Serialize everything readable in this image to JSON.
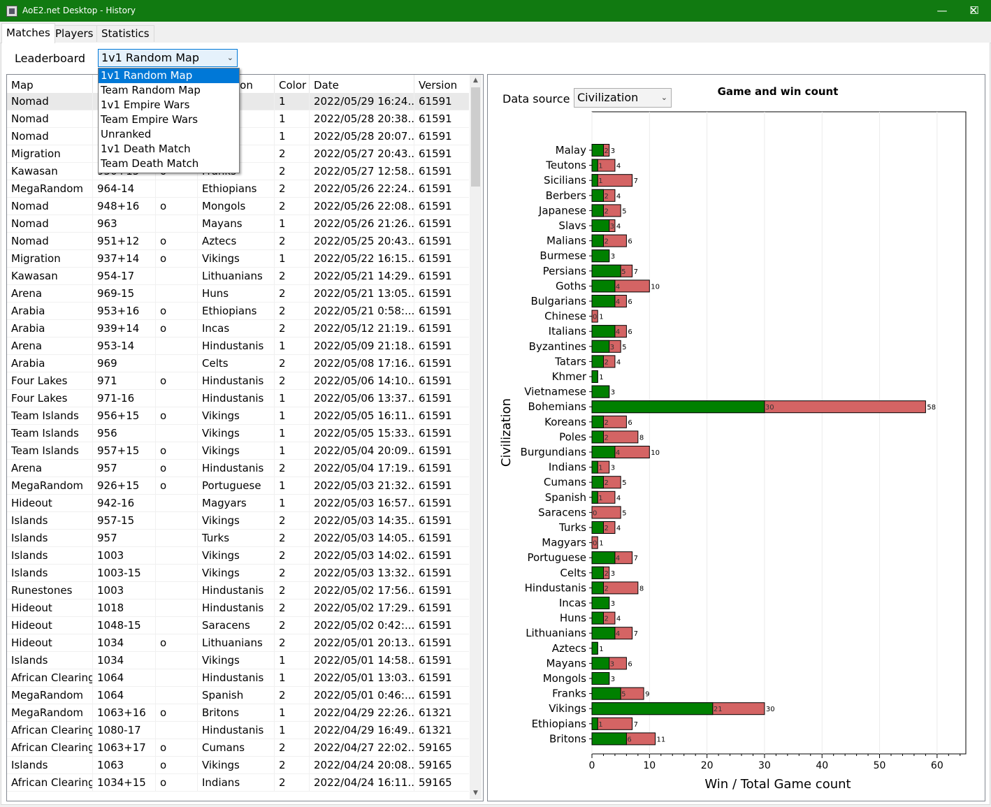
{
  "window": {
    "title": "AoE2.net Desktop - History",
    "minimize": "—",
    "maximize": "☐",
    "close": "✕"
  },
  "tabs": [
    "Matches",
    "Players",
    "Statistics"
  ],
  "leaderboard": {
    "label": "Leaderboard",
    "selected": "1v1 Random Map",
    "options": [
      "1v1 Random Map",
      "Team Random Map",
      "1v1 Empire Wars",
      "Team Empire Wars",
      "Unranked",
      "1v1 Death Match",
      "Team Death Match"
    ]
  },
  "grid": {
    "columns": [
      "Map",
      "",
      "",
      "ion",
      "Color",
      "Date",
      "Version"
    ],
    "rows": [
      [
        "Nomad",
        "9",
        "",
        "",
        "1",
        "2022/05/29 16:24...",
        "61591"
      ],
      [
        "Nomad",
        "",
        "",
        "",
        "1",
        "2022/05/28 20:38...",
        "61591"
      ],
      [
        "Nomad",
        "",
        "",
        "ans",
        "1",
        "2022/05/28 20:07...",
        "61591"
      ],
      [
        "Migration",
        "",
        "",
        "",
        "2",
        "2022/05/27 20:43...",
        "61591"
      ],
      [
        "Kawasan",
        "950+15",
        "o",
        "Franks",
        "2",
        "2022/05/27 12:58...",
        "61591"
      ],
      [
        "MegaRandom",
        "964-14",
        "",
        "Ethiopians",
        "2",
        "2022/05/26 22:24...",
        "61591"
      ],
      [
        "Nomad",
        "948+16",
        "o",
        "Mongols",
        "2",
        "2022/05/26 22:08...",
        "61591"
      ],
      [
        "Nomad",
        "963",
        "",
        "Mayans",
        "1",
        "2022/05/26 21:26...",
        "61591"
      ],
      [
        "Nomad",
        "951+12",
        "o",
        "Aztecs",
        "2",
        "2022/05/25 20:43...",
        "61591"
      ],
      [
        "Migration",
        "937+14",
        "o",
        "Vikings",
        "1",
        "2022/05/22 16:15...",
        "61591"
      ],
      [
        "Kawasan",
        "954-17",
        "",
        "Lithuanians",
        "2",
        "2022/05/21 14:29...",
        "61591"
      ],
      [
        "Arena",
        "969-15",
        "",
        "Huns",
        "2",
        "2022/05/21 13:05...",
        "61591"
      ],
      [
        "Arabia",
        "953+16",
        "o",
        "Ethiopians",
        "2",
        "2022/05/21 0:58:...",
        "61591"
      ],
      [
        "Arabia",
        "939+14",
        "o",
        "Incas",
        "2",
        "2022/05/12 21:19...",
        "61591"
      ],
      [
        "Arena",
        "953-14",
        "",
        "Hindustanis",
        "1",
        "2022/05/09 21:18...",
        "61591"
      ],
      [
        "Arabia",
        "969",
        "",
        "Celts",
        "2",
        "2022/05/08 17:16...",
        "61591"
      ],
      [
        "Four Lakes",
        "971",
        "o",
        "Hindustanis",
        "2",
        "2022/05/06 14:10...",
        "61591"
      ],
      [
        "Four Lakes",
        "971-16",
        "",
        "Hindustanis",
        "1",
        "2022/05/06 13:37...",
        "61591"
      ],
      [
        "Team Islands",
        "956+15",
        "o",
        "Vikings",
        "1",
        "2022/05/05 16:11...",
        "61591"
      ],
      [
        "Team Islands",
        "956",
        "",
        "Vikings",
        "1",
        "2022/05/05 15:33...",
        "61591"
      ],
      [
        "Team Islands",
        "957+15",
        "o",
        "Vikings",
        "1",
        "2022/05/04 20:09...",
        "61591"
      ],
      [
        "Arena",
        "957",
        "o",
        "Hindustanis",
        "2",
        "2022/05/04 17:19...",
        "61591"
      ],
      [
        "MegaRandom",
        "926+15",
        "o",
        "Portuguese",
        "1",
        "2022/05/03 21:32...",
        "61591"
      ],
      [
        "Hideout",
        "942-16",
        "",
        "Magyars",
        "1",
        "2022/05/03 16:57...",
        "61591"
      ],
      [
        "Islands",
        "957-15",
        "",
        "Vikings",
        "2",
        "2022/05/03 14:35...",
        "61591"
      ],
      [
        "Islands",
        "957",
        "",
        "Turks",
        "2",
        "2022/05/03 14:05...",
        "61591"
      ],
      [
        "Islands",
        "1003",
        "",
        "Vikings",
        "2",
        "2022/05/03 14:02...",
        "61591"
      ],
      [
        "Islands",
        "1003-15",
        "",
        "Vikings",
        "2",
        "2022/05/03 13:32...",
        "61591"
      ],
      [
        "Runestones",
        "1003",
        "",
        "Hindustanis",
        "2",
        "2022/05/02 17:56...",
        "61591"
      ],
      [
        "Hideout",
        "1018",
        "",
        "Hindustanis",
        "2",
        "2022/05/02 17:29...",
        "61591"
      ],
      [
        "Hideout",
        "1048-15",
        "",
        "Saracens",
        "2",
        "2022/05/02 0:42:...",
        "61591"
      ],
      [
        "Hideout",
        "1034",
        "o",
        "Lithuanians",
        "2",
        "2022/05/01 20:13...",
        "61591"
      ],
      [
        "Islands",
        "1034",
        "",
        "Vikings",
        "1",
        "2022/05/01 14:58...",
        "61591"
      ],
      [
        "African Clearing",
        "1064",
        "",
        "Hindustanis",
        "1",
        "2022/05/01 13:03...",
        "61591"
      ],
      [
        "MegaRandom",
        "1064",
        "",
        "Spanish",
        "2",
        "2022/05/01 0:46:...",
        "61591"
      ],
      [
        "MegaRandom",
        "1063+16",
        "o",
        "Britons",
        "1",
        "2022/04/29 22:26...",
        "61321"
      ],
      [
        "African Clearing",
        "1080-17",
        "",
        "Hindustanis",
        "1",
        "2022/04/29 16:49...",
        "61321"
      ],
      [
        "African Clearing",
        "1063+17",
        "o",
        "Cumans",
        "2",
        "2022/04/27 22:02...",
        "59165"
      ],
      [
        "Islands",
        "1063",
        "o",
        "Vikings",
        "2",
        "2022/04/24 20:08...",
        "59165"
      ],
      [
        "African Clearing",
        "1034+15",
        "o",
        "Indians",
        "2",
        "2022/04/24 16:11...",
        "59165"
      ]
    ]
  },
  "datasource": {
    "label": "Data source",
    "selected": "Civilization"
  },
  "colors": {
    "win": "#008000",
    "total": "#d46464",
    "titlebar": "#117a11"
  },
  "chart_data": {
    "type": "bar",
    "orientation": "horizontal",
    "title": "Game and win count",
    "xlabel": "Win / Total Game count",
    "ylabel": "Civilization",
    "xlim": [
      0,
      65
    ],
    "xticks": [
      0,
      10,
      20,
      30,
      40,
      50,
      60
    ],
    "categories": [
      "Malay",
      "Teutons",
      "Sicilians",
      "Berbers",
      "Japanese",
      "Slavs",
      "Malians",
      "Burmese",
      "Persians",
      "Goths",
      "Bulgarians",
      "Chinese",
      "Italians",
      "Byzantines",
      "Tatars",
      "Khmer",
      "Vietnamese",
      "Bohemians",
      "Koreans",
      "Poles",
      "Burgundians",
      "Indians",
      "Cumans",
      "Spanish",
      "Saracens",
      "Turks",
      "Magyars",
      "Portuguese",
      "Celts",
      "Hindustanis",
      "Incas",
      "Huns",
      "Lithuanians",
      "Aztecs",
      "Mayans",
      "Mongols",
      "Franks",
      "Vikings",
      "Ethiopians",
      "Britons"
    ],
    "series": [
      {
        "name": "Win",
        "values": [
          2,
          1,
          1,
          2,
          2,
          3,
          2,
          3,
          5,
          4,
          4,
          0,
          4,
          3,
          2,
          1,
          3,
          30,
          2,
          2,
          4,
          1,
          2,
          1,
          0,
          2,
          0,
          4,
          2,
          2,
          3,
          2,
          4,
          1,
          3,
          3,
          5,
          21,
          1,
          6
        ]
      },
      {
        "name": "Total",
        "values": [
          3,
          4,
          7,
          4,
          5,
          4,
          6,
          3,
          7,
          10,
          6,
          1,
          6,
          5,
          4,
          1,
          3,
          58,
          6,
          8,
          10,
          3,
          5,
          4,
          5,
          4,
          1,
          7,
          3,
          8,
          3,
          4,
          7,
          1,
          6,
          3,
          9,
          30,
          7,
          11
        ]
      }
    ]
  }
}
